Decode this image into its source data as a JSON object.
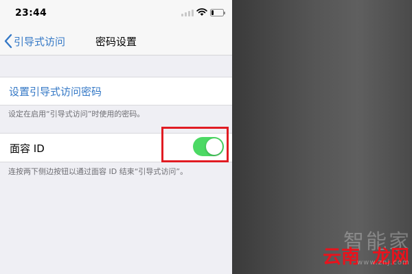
{
  "status_bar": {
    "time": "23:44",
    "icons": [
      "signal-icon",
      "wifi-icon",
      "battery-icon"
    ]
  },
  "nav_bar": {
    "back_label": "引导式访问",
    "title": "密码设置"
  },
  "settings": {
    "set_passcode_label": "设置引导式访问密码",
    "set_passcode_footer": "设定在启用“引导式访问”时使用的密码。",
    "face_id_label": "面容 ID",
    "face_id_enabled": true,
    "face_id_footer": "连按两下侧边按钮以通过面容 ID 结束“引导式访问”。"
  },
  "watermark": {
    "top_text": "智能家",
    "logo_left": "云南",
    "logo_right": "龙网",
    "url": "www.znj.com"
  },
  "colors": {
    "accent_blue": "#3478c6",
    "toggle_on": "#4cd964",
    "highlight_red": "#e11b22",
    "background": "#efeff4"
  }
}
